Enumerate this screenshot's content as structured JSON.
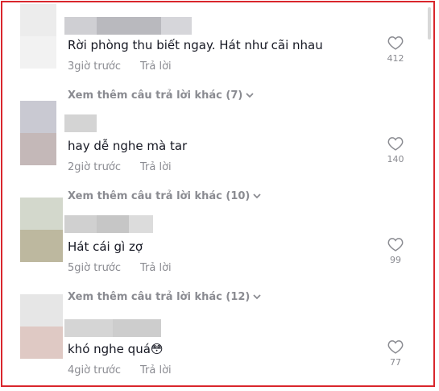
{
  "comments": [
    {
      "text": "Rời phòng thu biết ngay. Hát như cãi nhau",
      "time": "3giờ trước",
      "reply_label": "Trả lời",
      "likes": "412",
      "avatar_colors": [
        "#ececec",
        "#f2f2f2"
      ],
      "username_colors": [
        "#cfcfd3",
        "#b9b9be",
        "#d6d6da"
      ]
    },
    {
      "text": "hay dễ nghe mà tar",
      "time": "2giờ trước",
      "reply_label": "Trả lời",
      "likes": "140",
      "avatar_colors": [
        "#c9c9d2",
        "#c4b8b8"
      ],
      "username_colors": [
        "#d4d4d4"
      ]
    },
    {
      "text": "Hát cái gì zợ",
      "time": "5giờ trước",
      "reply_label": "Trả lời",
      "likes": "99",
      "avatar_colors": [
        "#d3d8cc",
        "#bdb89f"
      ],
      "username_colors": [
        "#d0d0d0",
        "#c6c6c6",
        "#dcdcdc"
      ]
    },
    {
      "text": "khó nghe quá😳",
      "time": "4giờ trước",
      "reply_label": "Trả lời",
      "likes": "77",
      "avatar_colors": [
        "#e6e6e6",
        "#dfc9c4"
      ],
      "username_colors": [
        "#d5d5d5",
        "#cdcdcd"
      ]
    }
  ],
  "view_more": [
    "Xem thêm câu trả lời khác (7)",
    "Xem thêm câu trả lời khác (10)",
    "Xem thêm câu trả lời khác (12)"
  ],
  "icons": {
    "like": "heart-outline-icon",
    "expand": "chevron-down-icon"
  },
  "colors": {
    "border": "#d9262c",
    "text": "#161823",
    "muted": "#8a8b91"
  }
}
